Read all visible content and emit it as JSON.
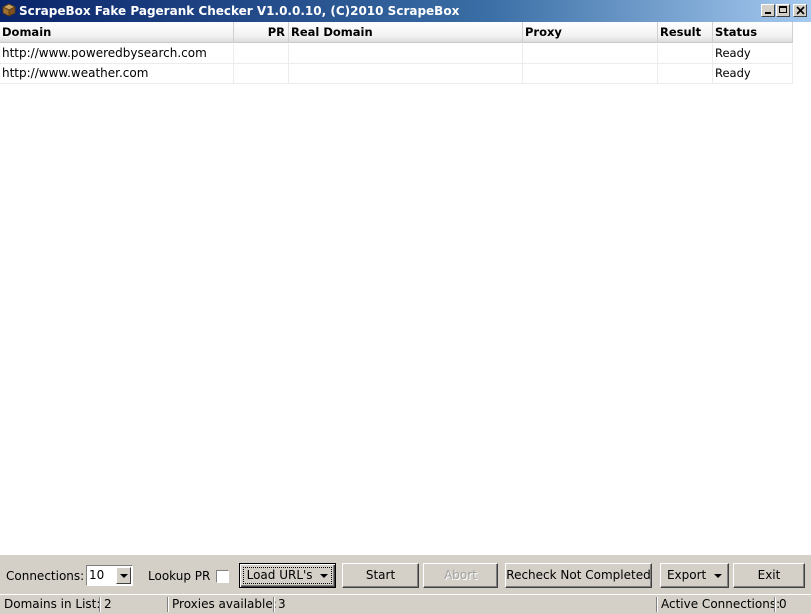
{
  "window": {
    "title": "ScrapeBox Fake Pagerank Checker V1.0.0.10, (C)2010 ScrapeBox"
  },
  "grid": {
    "columns": [
      "Domain",
      "PR",
      "Real Domain",
      "Proxy",
      "Result",
      "Status"
    ],
    "rows": [
      {
        "domain": "http://www.poweredbysearch.com",
        "pr": "",
        "real_domain": "",
        "proxy": "",
        "result": "",
        "status": "Ready"
      },
      {
        "domain": "http://www.weather.com",
        "pr": "",
        "real_domain": "",
        "proxy": "",
        "result": "",
        "status": "Ready"
      }
    ]
  },
  "controls": {
    "connections_label": "Connections:",
    "connections_value": "10",
    "lookup_pr_label": "Lookup PR",
    "lookup_pr_checked": false,
    "load_urls_label": "Load URL's",
    "start_label": "Start",
    "abort_label": "Abort",
    "recheck_label": "Recheck Not Completed",
    "export_label": "Export",
    "exit_label": "Exit"
  },
  "statusbar": {
    "domains_label": "Domains in List:",
    "domains_value": "2",
    "proxies_label": "Proxies available:",
    "proxies_value": "3",
    "active_label": "Active Connections:",
    "active_value": "0"
  },
  "colors": {
    "titlebar_start": "#0a246a",
    "titlebar_end": "#a6caf0",
    "face": "#d4d0c8"
  }
}
